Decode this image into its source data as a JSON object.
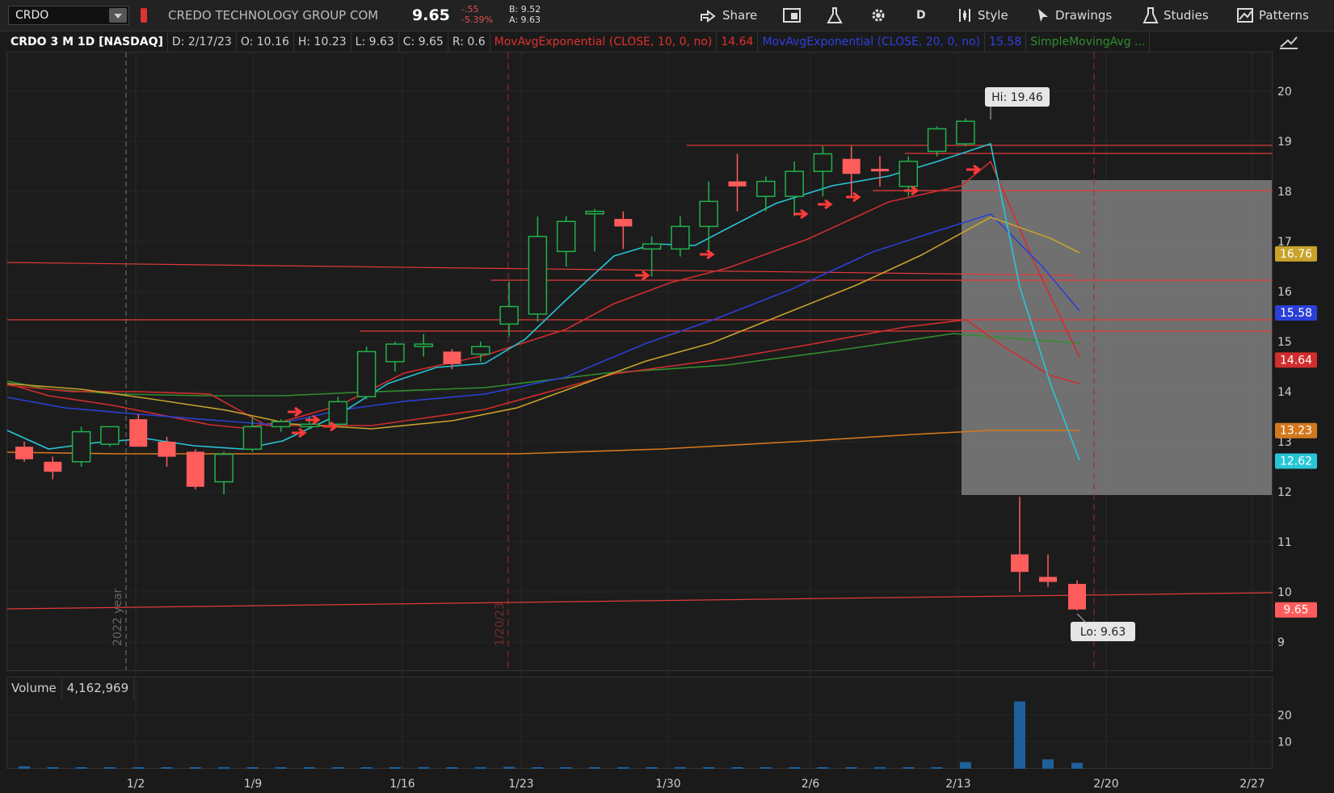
{
  "toolbar": {
    "symbol": "CRDO",
    "company": "CREDO TECHNOLOGY GROUP COM",
    "last_price": "9.65",
    "change": "-.55",
    "change_pct": "-5.39%",
    "bid": "B: 9.52",
    "ask": "A: 9.63",
    "share_label": "Share",
    "period_label": "D",
    "style_label": "Style",
    "drawings_label": "Drawings",
    "studies_label": "Studies",
    "patterns_label": "Patterns"
  },
  "header": {
    "title": "CRDO 3 M 1D [NASDAQ]",
    "date": "D: 2/17/23",
    "open": "O: 10.16",
    "high": "H: 10.23",
    "low": "L: 9.63",
    "close": "C: 9.65",
    "range": "R: 0.6",
    "study1": "MovAvgExponential (CLOSE, 10, 0, no)",
    "study1_value": "14.64",
    "study2": "MovAvgExponential (CLOSE, 20, 0, no)",
    "study2_value": "15.58",
    "study3": "SimpleMovingAvg ..."
  },
  "colors": {
    "up": "#22b14c",
    "down": "#ff5c5c",
    "ema10": "#d12d2d",
    "ema20": "#2b3fd6",
    "teal": "#27c6d6",
    "gold": "#c8a22a",
    "green_ma": "#2f8f2f",
    "orange_ma": "#d4781e"
  },
  "chart_data": {
    "type": "candlestick",
    "x_ticks": [
      "1/2",
      "1/9",
      "1/16",
      "1/23",
      "1/30",
      "2/6",
      "2/13",
      "2/20",
      "2/27"
    ],
    "y_ticks": [
      9,
      10,
      11,
      12,
      13,
      14,
      15,
      16,
      17,
      18,
      19,
      20
    ],
    "ylim": [
      8.5,
      20.5
    ],
    "markers": {
      "year": "2022 year",
      "date": "1/20/23"
    },
    "hi_label": "Hi: 19.46",
    "lo_label": "Lo: 9.63",
    "price_tags": [
      {
        "value": "16.76",
        "v": 16.76,
        "color": "#c8a22a"
      },
      {
        "value": "15.58",
        "v": 15.58,
        "color": "#2b3fd6"
      },
      {
        "value": "14.64",
        "v": 14.64,
        "color": "#d12d2d"
      },
      {
        "value": "13.23",
        "v": 13.23,
        "color": "#d4781e"
      },
      {
        "value": "12.62",
        "v": 12.62,
        "color": "#27c6d6"
      },
      {
        "value": "9.65",
        "v": 9.65,
        "color": "#ff5c5c"
      }
    ],
    "candles": [
      {
        "i": 0,
        "o": 12.9,
        "h": 13.0,
        "l": 12.6,
        "c": 12.65
      },
      {
        "i": 1,
        "o": 12.6,
        "h": 12.7,
        "l": 12.25,
        "c": 12.4
      },
      {
        "i": 2,
        "o": 12.6,
        "h": 13.3,
        "l": 12.5,
        "c": 13.2
      },
      {
        "i": 3,
        "o": 12.95,
        "h": 13.3,
        "l": 12.9,
        "c": 13.3
      },
      {
        "i": 4,
        "o": 13.45,
        "h": 13.55,
        "l": 12.9,
        "c": 12.9
      },
      {
        "i": 5,
        "o": 13.0,
        "h": 13.1,
        "l": 12.5,
        "c": 12.7
      },
      {
        "i": 6,
        "o": 12.8,
        "h": 12.85,
        "l": 12.05,
        "c": 12.1
      },
      {
        "i": 7,
        "o": 12.2,
        "h": 12.8,
        "l": 11.95,
        "c": 12.75
      },
      {
        "i": 8,
        "o": 12.85,
        "h": 13.5,
        "l": 12.8,
        "c": 13.3
      },
      {
        "i": 9,
        "o": 13.3,
        "h": 13.45,
        "l": 13.2,
        "c": 13.4
      },
      {
        "i": 10,
        "o": 13.35,
        "h": 13.5,
        "l": 13.25,
        "c": 13.35
      },
      {
        "i": 11,
        "o": 13.35,
        "h": 13.9,
        "l": 13.3,
        "c": 13.8
      },
      {
        "i": 12,
        "o": 13.9,
        "h": 14.9,
        "l": 13.85,
        "c": 14.8
      },
      {
        "i": 13,
        "o": 14.6,
        "h": 15.0,
        "l": 14.4,
        "c": 14.95
      },
      {
        "i": 14,
        "o": 14.95,
        "h": 15.15,
        "l": 14.7,
        "c": 14.95
      },
      {
        "i": 15,
        "o": 14.8,
        "h": 14.85,
        "l": 14.45,
        "c": 14.55
      },
      {
        "i": 16,
        "o": 14.75,
        "h": 15.0,
        "l": 14.6,
        "c": 14.9
      },
      {
        "i": 17,
        "o": 15.35,
        "h": 16.2,
        "l": 15.1,
        "c": 15.7
      },
      {
        "i": 18,
        "o": 15.55,
        "h": 17.5,
        "l": 15.4,
        "c": 17.1
      },
      {
        "i": 19,
        "o": 16.8,
        "h": 17.5,
        "l": 16.5,
        "c": 17.4
      },
      {
        "i": 20,
        "o": 17.6,
        "h": 17.65,
        "l": 16.8,
        "c": 17.6
      },
      {
        "i": 21,
        "o": 17.45,
        "h": 17.6,
        "l": 16.85,
        "c": 17.3
      },
      {
        "i": 22,
        "o": 16.85,
        "h": 17.1,
        "l": 16.3,
        "c": 16.95
      },
      {
        "i": 23,
        "o": 16.85,
        "h": 17.5,
        "l": 16.7,
        "c": 17.3
      },
      {
        "i": 24,
        "o": 17.3,
        "h": 18.2,
        "l": 16.8,
        "c": 17.8
      },
      {
        "i": 25,
        "o": 18.2,
        "h": 18.75,
        "l": 17.6,
        "c": 18.1
      },
      {
        "i": 26,
        "o": 17.9,
        "h": 18.3,
        "l": 17.6,
        "c": 18.2
      },
      {
        "i": 27,
        "o": 17.9,
        "h": 18.6,
        "l": 17.5,
        "c": 18.4
      },
      {
        "i": 28,
        "o": 18.4,
        "h": 18.9,
        "l": 17.9,
        "c": 18.75
      },
      {
        "i": 29,
        "o": 18.65,
        "h": 18.9,
        "l": 17.9,
        "c": 18.35
      },
      {
        "i": 30,
        "o": 18.45,
        "h": 18.7,
        "l": 18.1,
        "c": 18.4
      },
      {
        "i": 31,
        "o": 18.1,
        "h": 18.7,
        "l": 17.9,
        "c": 18.6
      },
      {
        "i": 32,
        "o": 18.8,
        "h": 19.3,
        "l": 18.7,
        "c": 19.25
      },
      {
        "i": 33,
        "o": 18.95,
        "h": 19.46,
        "l": 18.9,
        "c": 19.4
      },
      {
        "i": 34,
        "o": 10.75,
        "h": 11.9,
        "l": 10.0,
        "c": 10.4
      },
      {
        "i": 35,
        "o": 10.3,
        "h": 10.75,
        "l": 10.1,
        "c": 10.2
      },
      {
        "i": 36,
        "o": 10.16,
        "h": 10.23,
        "l": 9.63,
        "c": 9.65
      }
    ],
    "volume": {
      "label": "Volume",
      "value": "4,162,969",
      "y_ticks": [
        10,
        20
      ],
      "bars": [
        0.9,
        0.4,
        0.5,
        0.4,
        0.5,
        0.4,
        0.4,
        0.5,
        0.4,
        0.4,
        0.4,
        0.5,
        0.4,
        0.6,
        0.5,
        0.4,
        0.4,
        0.7,
        0.6,
        0.5,
        0.4,
        0.4,
        0.5,
        0.4,
        0.5,
        0.6,
        0.5,
        0.4,
        0.4,
        0.5,
        0.5,
        0.4,
        0.5,
        2.5,
        25,
        3.5,
        2.2
      ]
    }
  }
}
